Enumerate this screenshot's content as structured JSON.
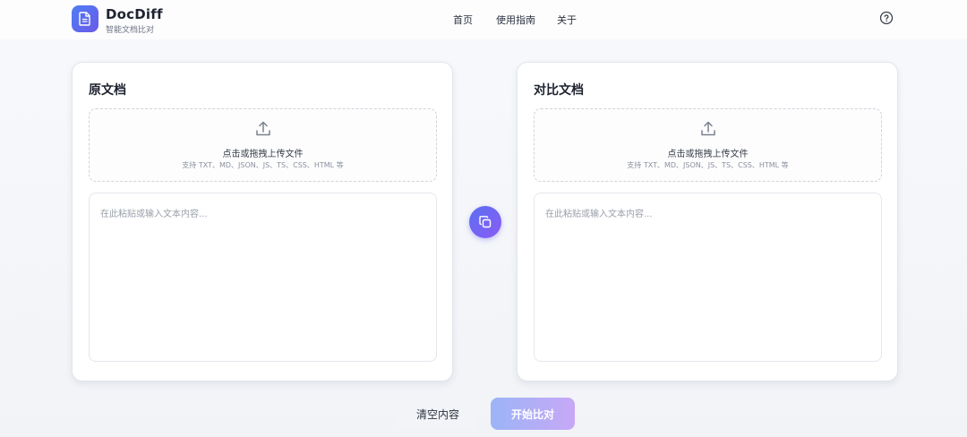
{
  "header": {
    "brand_title": "DocDiff",
    "brand_subtitle": "智能文档比对",
    "logo_icon": "document-icon",
    "nav": [
      {
        "label": "首页"
      },
      {
        "label": "使用指南"
      },
      {
        "label": "关于"
      }
    ],
    "help_icon": "question-circle-icon"
  },
  "panels": {
    "original": {
      "title": "原文档",
      "upload_main": "点击或拖拽上传文件",
      "upload_hint": "支持 TXT、MD、JSON、JS、TS、CSS、HTML 等",
      "placeholder": "在此粘贴或输入文本内容...",
      "value": ""
    },
    "compare": {
      "title": "对比文档",
      "upload_main": "点击或拖拽上传文件",
      "upload_hint": "支持 TXT、MD、JSON、JS、TS、CSS、HTML 等",
      "placeholder": "在此粘贴或输入文本内容...",
      "value": ""
    }
  },
  "swap_icon": "copy-icon",
  "actions": {
    "clear_label": "清空内容",
    "start_label": "开始比对"
  },
  "colors": {
    "accent_start": "#4f7df5",
    "accent_end": "#8b5cf6"
  }
}
